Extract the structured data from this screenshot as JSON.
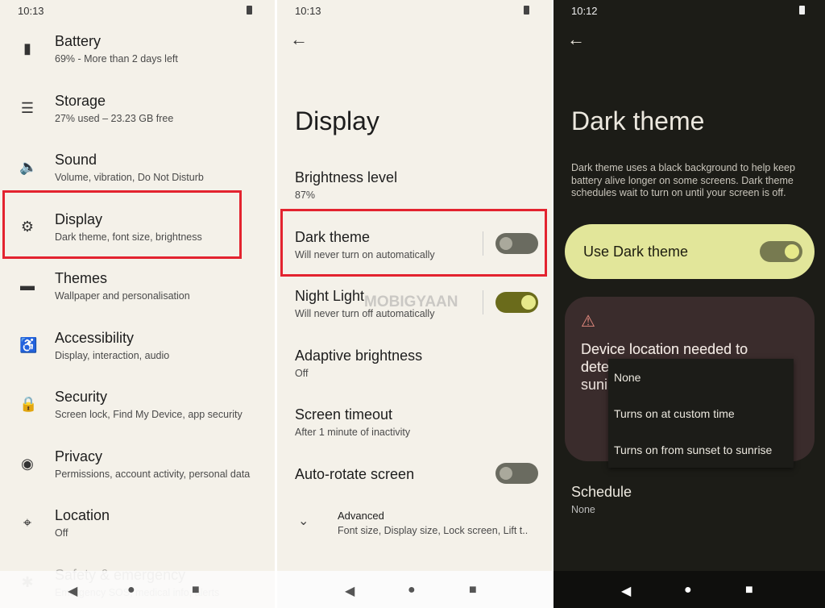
{
  "left": {
    "time": "10:13",
    "items": [
      {
        "icon": "battery-icon",
        "title": "Battery",
        "sub": "69% - More than 2 days left"
      },
      {
        "icon": "storage-icon",
        "title": "Storage",
        "sub": "27% used – 23.23 GB free"
      },
      {
        "icon": "sound-icon",
        "title": "Sound",
        "sub": "Volume, vibration, Do Not Disturb"
      },
      {
        "icon": "display-icon",
        "title": "Display",
        "sub": "Dark theme, font size, brightness"
      },
      {
        "icon": "themes-icon",
        "title": "Themes",
        "sub": "Wallpaper and personalisation"
      },
      {
        "icon": "accessibility-icon",
        "title": "Accessibility",
        "sub": "Display, interaction, audio"
      },
      {
        "icon": "lock-icon",
        "title": "Security",
        "sub": "Screen lock, Find My Device, app security"
      },
      {
        "icon": "privacy-icon",
        "title": "Privacy",
        "sub": "Permissions, account activity, personal data"
      },
      {
        "icon": "location-icon",
        "title": "Location",
        "sub": "Off"
      },
      {
        "icon": "asterisk-icon",
        "title": "Safety & emergency",
        "sub": "Emergency SOS, medical info, alerts"
      }
    ]
  },
  "middle": {
    "time": "10:13",
    "title": "Display",
    "items": [
      {
        "title": "Brightness level",
        "sub": "87%"
      },
      {
        "title": "Dark theme",
        "sub": "Will never turn on automatically",
        "toggle": false
      },
      {
        "title": "Night Light",
        "sub": "Will never turn off automatically",
        "toggle": true
      },
      {
        "title": "Adaptive brightness",
        "sub": "Off"
      },
      {
        "title": "Screen timeout",
        "sub": "After 1 minute of inactivity"
      },
      {
        "title": "Auto-rotate screen",
        "toggle": false
      },
      {
        "title": "Advanced",
        "sub": "Font size, Display size, Lock screen, Lift t.."
      }
    ],
    "watermark": "MOBIGYAAN"
  },
  "right": {
    "time": "10:12",
    "title": "Dark theme",
    "description": "Dark theme uses a black background to help keep battery alive longer on some screens. Dark theme schedules wait to turn on until your screen is off.",
    "use_dark_theme": "Use Dark theme",
    "use_dark_theme_on": false,
    "warning": "Device location needed to determine sunset and sunrise",
    "warning_visible": [
      "Device location needed to",
      "dete",
      "suni"
    ],
    "dropdown": [
      "None",
      "Turns on at custom time",
      "Turns on from sunset to sunrise"
    ],
    "schedule": {
      "title": "Schedule",
      "value": "None"
    }
  },
  "colors": {
    "highlight": "#e3232f",
    "accent_card": "#e2e69a",
    "toggle_on": "#6a6b1b"
  }
}
